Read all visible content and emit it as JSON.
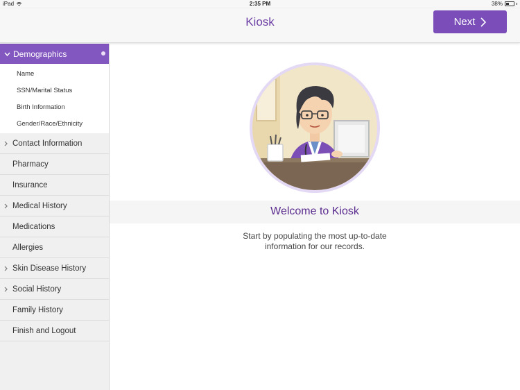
{
  "status_bar": {
    "device": "iPad",
    "time": "2:35 PM",
    "battery": "38%"
  },
  "header": {
    "title": "Kiosk",
    "next_label": "Next"
  },
  "sidebar": {
    "active": {
      "label": "Demographics"
    },
    "subitems": [
      "Name",
      "SSN/Marital Status",
      "Birth Information",
      "Gender/Race/Ethnicity"
    ],
    "items": [
      {
        "label": "Contact Information",
        "chevron": true
      },
      {
        "label": "Pharmacy",
        "chevron": false
      },
      {
        "label": "Insurance",
        "chevron": false
      },
      {
        "label": "Medical History",
        "chevron": true
      },
      {
        "label": "Medications",
        "chevron": false
      },
      {
        "label": "Allergies",
        "chevron": false
      },
      {
        "label": "Skin Disease History",
        "chevron": true
      },
      {
        "label": "Social History",
        "chevron": true
      },
      {
        "label": "Family History",
        "chevron": false
      },
      {
        "label": "Finish and Logout",
        "chevron": false
      }
    ]
  },
  "main": {
    "welcome_title": "Welcome to Kiosk",
    "subtitle_line1": "Start by populating the most up-to-date",
    "subtitle_line2": "information for our records."
  },
  "colors": {
    "accent": "#7a4db8",
    "active_nav": "#8357c0",
    "title": "#6d3fa5"
  }
}
